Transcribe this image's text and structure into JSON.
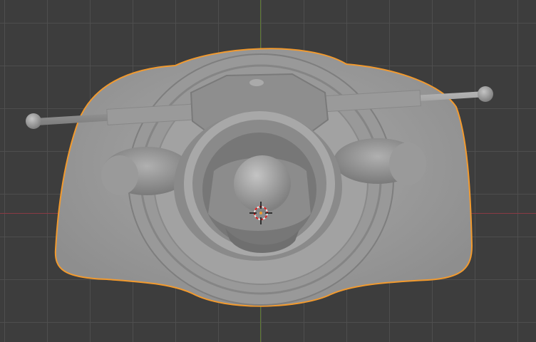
{
  "viewport": {
    "grid_visible": true,
    "x_axis_color": "#8a3a44",
    "y_axis_color": "#5e7a33",
    "background_color": "#3d3d3d"
  },
  "selected_object": {
    "shading": "solid",
    "outline_color": "#f29a2e",
    "base_color": "#9c9c9c"
  },
  "icons": {
    "cursor": "3d-cursor-icon"
  }
}
